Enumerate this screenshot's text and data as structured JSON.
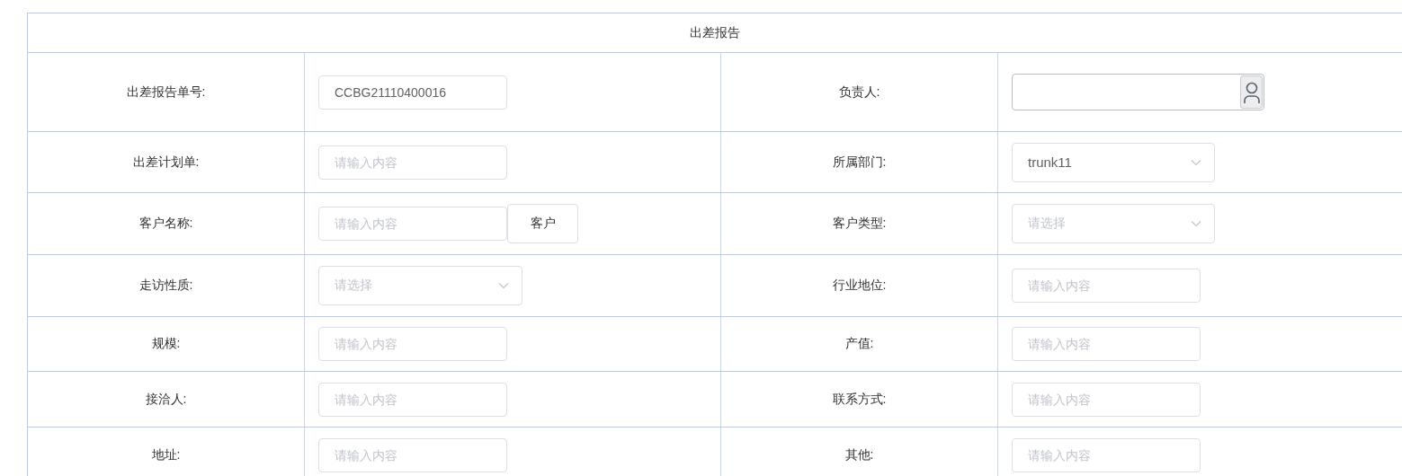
{
  "title": "出差报告",
  "rows": [
    {
      "cells": [
        {
          "label": "出差报告单号:",
          "control": {
            "kind": "input",
            "value": "CCBG21110400016"
          }
        },
        {
          "label": "负责人:",
          "control": {
            "kind": "user-picker"
          }
        }
      ]
    },
    {
      "cells": [
        {
          "label": "出差计划单:",
          "control": {
            "kind": "input",
            "placeholder": "请输入内容"
          }
        },
        {
          "label": "所属部门:",
          "control": {
            "kind": "select",
            "value": "trunk11"
          }
        }
      ]
    },
    {
      "cells": [
        {
          "label": "客户名称:",
          "control": {
            "kind": "input-button",
            "placeholder": "请输入内容",
            "button": "客户"
          }
        },
        {
          "label": "客户类型:",
          "control": {
            "kind": "select",
            "placeholder": "请选择"
          }
        }
      ]
    },
    {
      "cells": [
        {
          "label": "走访性质:",
          "control": {
            "kind": "select",
            "placeholder": "请选择"
          }
        },
        {
          "label": "行业地位:",
          "control": {
            "kind": "input",
            "placeholder": "请输入内容"
          }
        }
      ]
    },
    {
      "cells": [
        {
          "label": "规模:",
          "control": {
            "kind": "input",
            "placeholder": "请输入内容"
          }
        },
        {
          "label": "产值:",
          "control": {
            "kind": "input",
            "placeholder": "请输入内容"
          }
        }
      ]
    },
    {
      "cells": [
        {
          "label": "接洽人:",
          "control": {
            "kind": "input",
            "placeholder": "请输入内容"
          }
        },
        {
          "label": "联系方式:",
          "control": {
            "kind": "input",
            "placeholder": "请输入内容"
          }
        }
      ]
    },
    {
      "cells": [
        {
          "label": "地址:",
          "control": {
            "kind": "input",
            "placeholder": "请输入内容"
          }
        },
        {
          "label": "其他:",
          "control": {
            "kind": "input",
            "placeholder": "请输入内容"
          }
        }
      ]
    }
  ]
}
